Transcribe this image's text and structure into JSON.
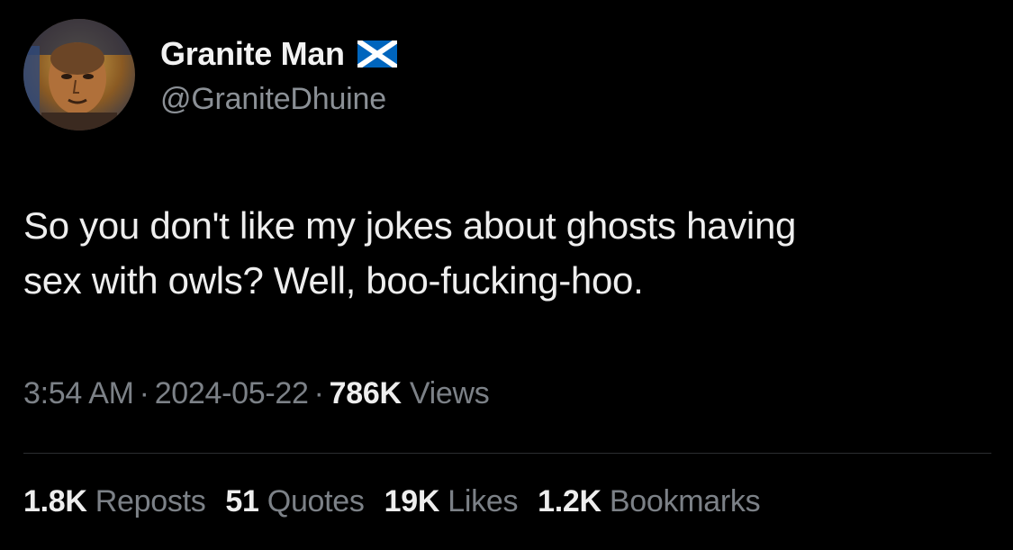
{
  "author": {
    "display_name": "Granite Man",
    "flag_icon": "scotland-flag-icon",
    "handle": "@GraniteDhuine",
    "avatar_icon": "profile-avatar"
  },
  "tweet": {
    "text_line_1": "So you don't like my jokes about ghosts having",
    "text_line_2": "sex with owls? Well, boo-fucking-hoo."
  },
  "meta": {
    "time": "3:54 AM",
    "separator": "·",
    "date": "2024-05-22",
    "views_count": "786K",
    "views_label": "Views"
  },
  "stats": [
    {
      "count": "1.8K",
      "label": "Reposts"
    },
    {
      "count": "51",
      "label": "Quotes"
    },
    {
      "count": "19K",
      "label": "Likes"
    },
    {
      "count": "1.2K",
      "label": "Bookmarks"
    }
  ],
  "colors": {
    "background": "#000000",
    "primary_text": "#eeeeee",
    "secondary_text": "#7c8187",
    "flag_blue": "#0065bd",
    "flag_white": "#ffffff"
  }
}
